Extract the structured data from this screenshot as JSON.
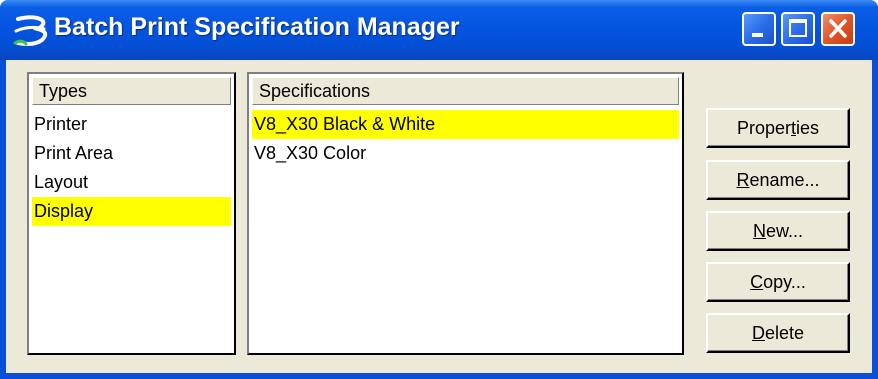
{
  "window": {
    "title": "Batch Print Specification Manager",
    "icon": "bentley-b-icon"
  },
  "types": {
    "header": "Types",
    "items": [
      "Printer",
      "Print Area",
      "Layout",
      "Display"
    ],
    "selected": "Display"
  },
  "specifications": {
    "header": "Specifications",
    "items": [
      "V8_X30 Black & White",
      "V8_X30 Color"
    ],
    "selected": "V8_X30 Black & White"
  },
  "buttons": {
    "properties": {
      "pre": "Proper",
      "mn": "t",
      "post": "ies"
    },
    "rename": {
      "pre": "",
      "mn": "R",
      "post": "ename..."
    },
    "new": {
      "pre": "",
      "mn": "N",
      "post": "ew..."
    },
    "copy": {
      "pre": "",
      "mn": "C",
      "post": "opy..."
    },
    "delete": {
      "pre": "",
      "mn": "D",
      "post": "elete"
    }
  },
  "colors": {
    "selection": "#ffff00",
    "titlebar": "#0554e0",
    "dialog_bg": "#ece9d8"
  }
}
